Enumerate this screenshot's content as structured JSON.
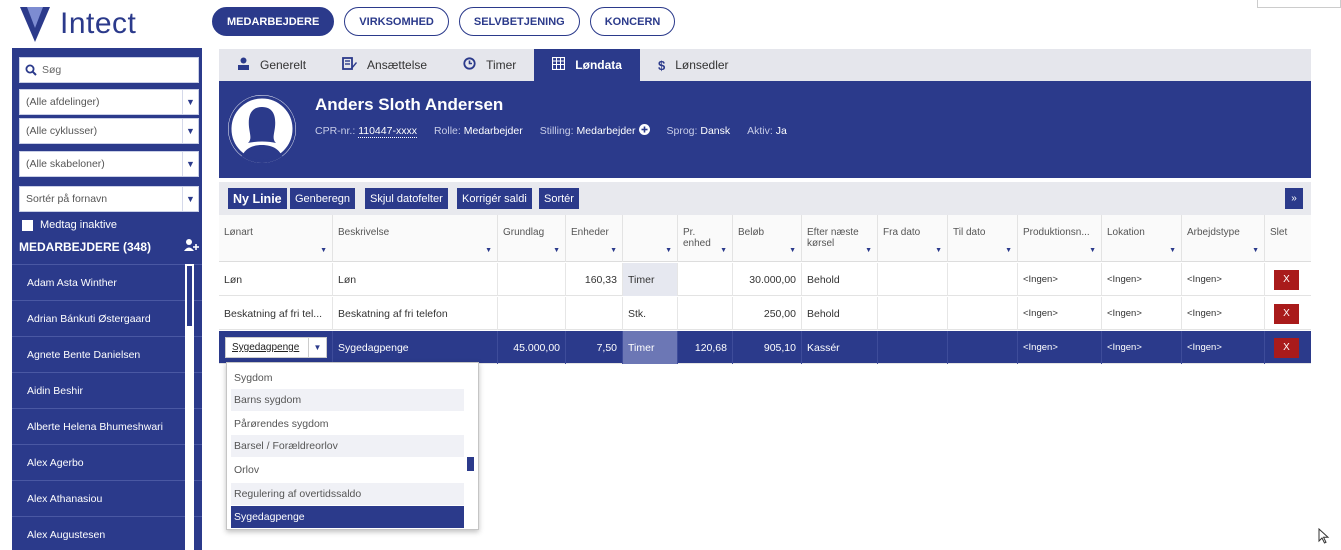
{
  "app": {
    "name": "Intect",
    "brand_color": "#2b3a8b",
    "danger_color": "#a91b1b"
  },
  "topnav": [
    {
      "label": "MEDARBEJDERE",
      "active": true
    },
    {
      "label": "VIRKSOMHED",
      "active": false
    },
    {
      "label": "SELVBETJENING",
      "active": false
    },
    {
      "label": "KONCERN",
      "active": false
    }
  ],
  "sidebar": {
    "search": {
      "label": "Søg",
      "icon": "search-icon"
    },
    "filters": [
      "(Alle afdelinger)",
      "(Alle cyklusser)",
      "(Alle skabeloner)",
      "Sortér på fornavn"
    ],
    "include_inactive": "Medtag inaktive",
    "employees_header": "MEDARBEJDERE (348)",
    "employees": [
      "Adam Asta Winther",
      "Adrian Bánkuti Østergaard",
      "Agnete Bente Danielsen",
      "Aidin Beshir",
      "Alberte Helena Bhumeshwari",
      "Alex Agerbo",
      "Alex Athanasiou",
      "Alex Augustesen"
    ]
  },
  "tabs": [
    {
      "label": "Generelt",
      "icon": "person-icon"
    },
    {
      "label": "Ansættelse",
      "icon": "edit-document-icon"
    },
    {
      "label": "Timer",
      "icon": "clock-icon"
    },
    {
      "label": "Løndata",
      "icon": "table-icon",
      "active": true
    },
    {
      "label": "Lønsedler",
      "icon": "dollar-icon"
    }
  ],
  "profile": {
    "name": "Anders Sloth Andersen",
    "cpr_label": "CPR-nr.:",
    "cpr_value": "110447-xxxx",
    "rolle_label": "Rolle:",
    "rolle_value": "Medarbejder",
    "stilling_label": "Stilling:",
    "stilling_value": "Medarbejder",
    "sprog_label": "Sprog:",
    "sprog_value": "Dansk",
    "aktiv_label": "Aktiv:",
    "aktiv_value": "Ja"
  },
  "toolbar": {
    "new_line": "Ny Linie",
    "recalc": "Genberegn",
    "hide_dates": "Skjul datofelter",
    "correct": "Korrigér saldi",
    "sort": "Sortér",
    "expand": "»"
  },
  "grid": {
    "columns": [
      {
        "l1": "Lønart",
        "l2": ""
      },
      {
        "l1": "Beskrivelse",
        "l2": ""
      },
      {
        "l1": "Grundlag",
        "l2": ""
      },
      {
        "l1": "Enheder",
        "l2": ""
      },
      {
        "l1": "",
        "l2": ""
      },
      {
        "l1": "Pr.",
        "l2": "enhed"
      },
      {
        "l1": "Beløb",
        "l2": ""
      },
      {
        "l1": "Efter næste",
        "l2": "kørsel"
      },
      {
        "l1": "Fra dato",
        "l2": ""
      },
      {
        "l1": "Til dato",
        "l2": ""
      },
      {
        "l1": "Produktionsn...",
        "l2": ""
      },
      {
        "l1": "Lokation",
        "l2": ""
      },
      {
        "l1": "Arbejdstype",
        "l2": ""
      },
      {
        "l1": "Slet",
        "l2": ""
      }
    ],
    "rows": [
      [
        "Løn",
        "Løn",
        "",
        "160,33",
        "Timer",
        "",
        "30.000,00",
        "Behold",
        "",
        "",
        "<Ingen>",
        "<Ingen>",
        "<Ingen>",
        "X"
      ],
      [
        "Beskatning af fri tel...",
        "Beskatning af fri telefon",
        "",
        "",
        "Stk.",
        "",
        "250,00",
        "Behold",
        "",
        "",
        "<Ingen>",
        "<Ingen>",
        "<Ingen>",
        "X"
      ],
      [
        "Sygedagpenge",
        "Sygedagpenge",
        "45.000,00",
        "7,50",
        "Timer",
        "120,68",
        "905,10",
        "Kassér",
        "",
        "",
        "<Ingen>",
        "<Ingen>",
        "<Ingen>",
        "X"
      ]
    ]
  },
  "dropdown": {
    "items": [
      "Sygdom",
      "Barns sygdom",
      "Pårørendes sygdom",
      "Barsel / Forældreorlov",
      "Orlov",
      "Regulering af overtidssaldo",
      "Sygedagpenge"
    ],
    "selected": 6
  }
}
